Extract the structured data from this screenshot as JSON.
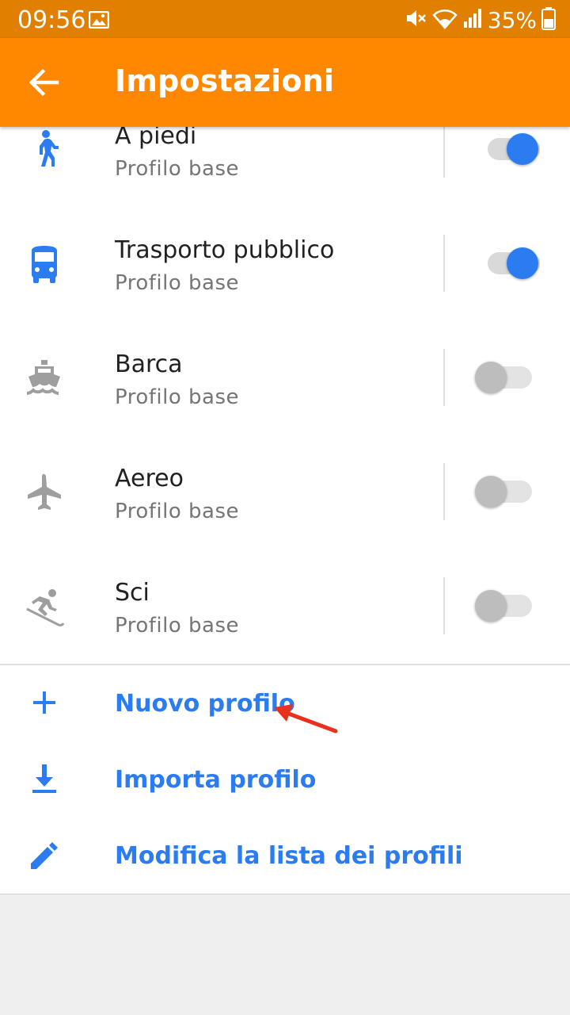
{
  "status_bar": {
    "time": "09:56",
    "battery": "35%",
    "icons": [
      "gallery-icon",
      "mute-icon",
      "wifi-icon",
      "signal-icon",
      "battery-icon"
    ]
  },
  "app_bar": {
    "title": "Impostazioni",
    "back_icon": "arrow-back-icon"
  },
  "profiles": [
    {
      "name": "A piedi",
      "subtitle": "Profilo base",
      "icon": "walk-icon",
      "enabled": true
    },
    {
      "name": "Trasporto pubblico",
      "subtitle": "Profilo base",
      "icon": "bus-icon",
      "enabled": true
    },
    {
      "name": "Barca",
      "subtitle": "Profilo base",
      "icon": "boat-icon",
      "enabled": false
    },
    {
      "name": "Aereo",
      "subtitle": "Profilo base",
      "icon": "airplane-icon",
      "enabled": false
    },
    {
      "name": "Sci",
      "subtitle": "Profilo base",
      "icon": "ski-icon",
      "enabled": false
    }
  ],
  "actions": [
    {
      "label": "Nuovo profilo",
      "icon": "add-icon"
    },
    {
      "label": "Importa profilo",
      "icon": "download-icon"
    },
    {
      "label": "Modifica la lista dei profili",
      "icon": "edit-icon"
    }
  ],
  "colors": {
    "status_bar": "#e07f00",
    "app_bar": "#ff8800",
    "accent_blue": "#2a7cf0",
    "icon_gray": "#9e9e9e",
    "annotation_arrow": "#e8321e"
  }
}
